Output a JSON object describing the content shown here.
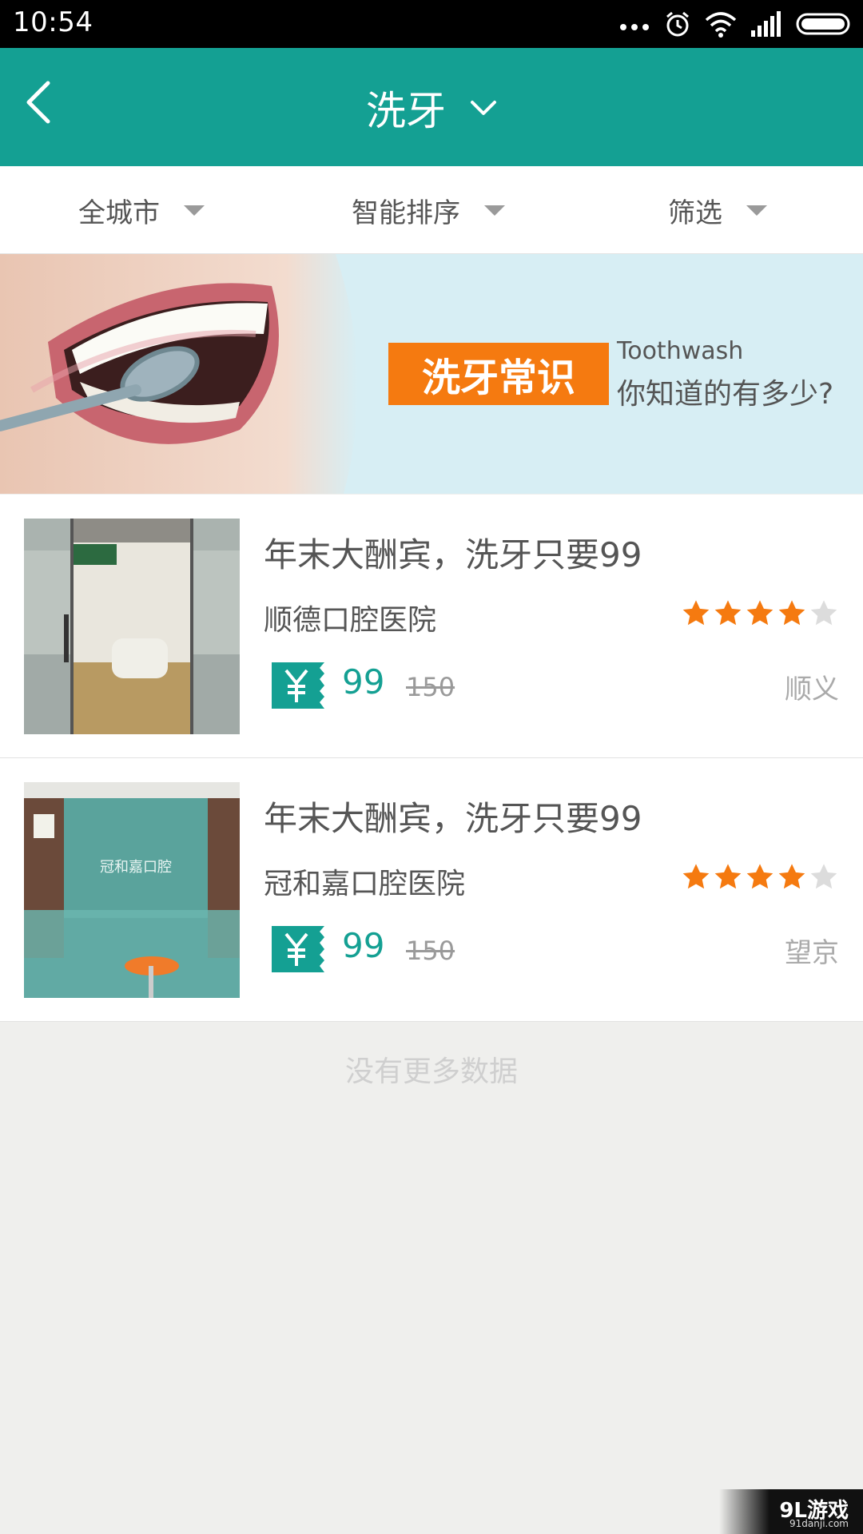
{
  "statusbar": {
    "time": "10:54",
    "icons": [
      "more-dots-icon",
      "alarm-icon",
      "wifi-icon",
      "signal-icon",
      "battery-icon"
    ]
  },
  "appbar": {
    "title": "洗牙",
    "back_icon": "back-chevron-icon",
    "dropdown_icon": "chevron-down-icon",
    "bg_color": "#14a093"
  },
  "filters": [
    {
      "label": "全城市"
    },
    {
      "label": "智能排序"
    },
    {
      "label": "筛选"
    }
  ],
  "banner": {
    "badge": "洗牙常识",
    "en": "Toothwash",
    "tagline": "你知道的有多少?",
    "badge_color": "#f57a10"
  },
  "items": [
    {
      "title": "年末大酬宾，洗牙只要99",
      "name": "顺德口腔医院",
      "rating": 4,
      "rating_max": 5,
      "price": "99",
      "old_price": "150",
      "area": "顺义"
    },
    {
      "title": "年末大酬宾，洗牙只要99",
      "name": "冠和嘉口腔医院",
      "rating": 4,
      "rating_max": 5,
      "price": "99",
      "old_price": "150",
      "area": "望京"
    }
  ],
  "footer": {
    "no_more": "没有更多数据"
  },
  "watermark": {
    "logo": "9L游戏",
    "url": "91danji.com"
  },
  "colors": {
    "accent": "#14a093",
    "star": "#f57a10",
    "star_empty": "#dcdcdc"
  }
}
